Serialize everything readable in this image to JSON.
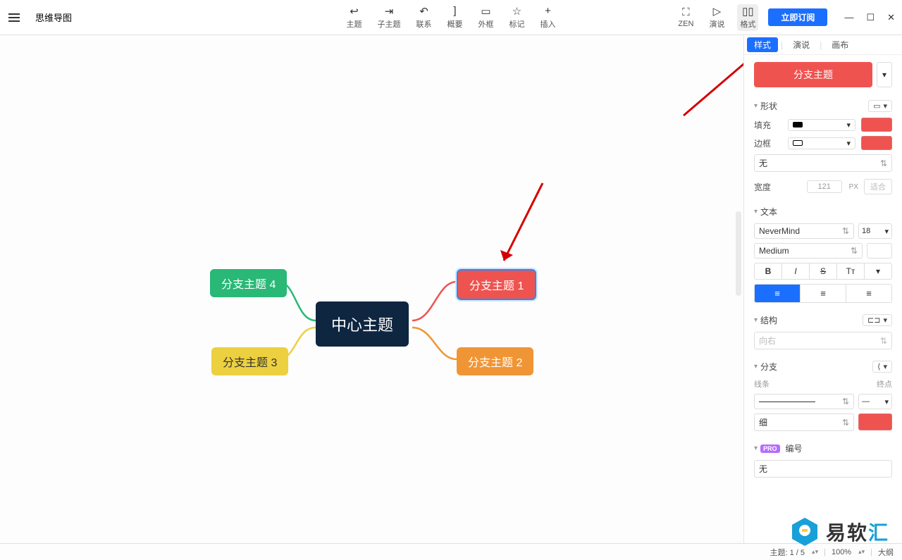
{
  "app": {
    "tab_title": "思维导图"
  },
  "toolbar": {
    "items": [
      {
        "label": "主题",
        "icon": "↩"
      },
      {
        "label": "子主题",
        "icon": "⇥"
      },
      {
        "label": "联系",
        "icon": "↶"
      },
      {
        "label": "概要",
        "icon": "]"
      },
      {
        "label": "外框",
        "icon": "▭"
      },
      {
        "label": "标记",
        "icon": "☆"
      },
      {
        "label": "插入",
        "icon": "+"
      }
    ],
    "right": [
      {
        "label": "ZEN",
        "icon": "⛶"
      },
      {
        "label": "演说",
        "icon": "▷"
      },
      {
        "label": "格式",
        "icon": "▯▯",
        "active": true
      }
    ],
    "subscribe": "立即订阅"
  },
  "canvas": {
    "center": "中心主题",
    "b1": "分支主题 1",
    "b2": "分支主题 2",
    "b3": "分支主题 3",
    "b4": "分支主题 4"
  },
  "panel": {
    "tabs": {
      "style": "样式",
      "present": "演说",
      "canvas": "画布"
    },
    "topic_type": "分支主题",
    "shape": {
      "title": "形状",
      "fill": "填充",
      "border": "边框",
      "border_style": "无",
      "width_label": "宽度",
      "width_value": "121",
      "width_unit": "PX",
      "fit": "适合"
    },
    "text": {
      "title": "文本",
      "font": "NeverMind",
      "size": "18",
      "weight": "Medium",
      "bold": "B",
      "italic": "I",
      "strike": "S",
      "case": "Tᴛ"
    },
    "structure": {
      "title": "结构",
      "direction": "向右"
    },
    "branch": {
      "title": "分支",
      "line": "线条",
      "endpoint": "终点",
      "thickness": "细"
    },
    "number": {
      "title": "编号",
      "value": "无",
      "pro": "PRO"
    }
  },
  "status": {
    "topic": "主题: 1 / 5",
    "zoom": "100%",
    "outline": "大纲"
  },
  "watermark": {
    "text1": "易软",
    "text2": "汇"
  }
}
